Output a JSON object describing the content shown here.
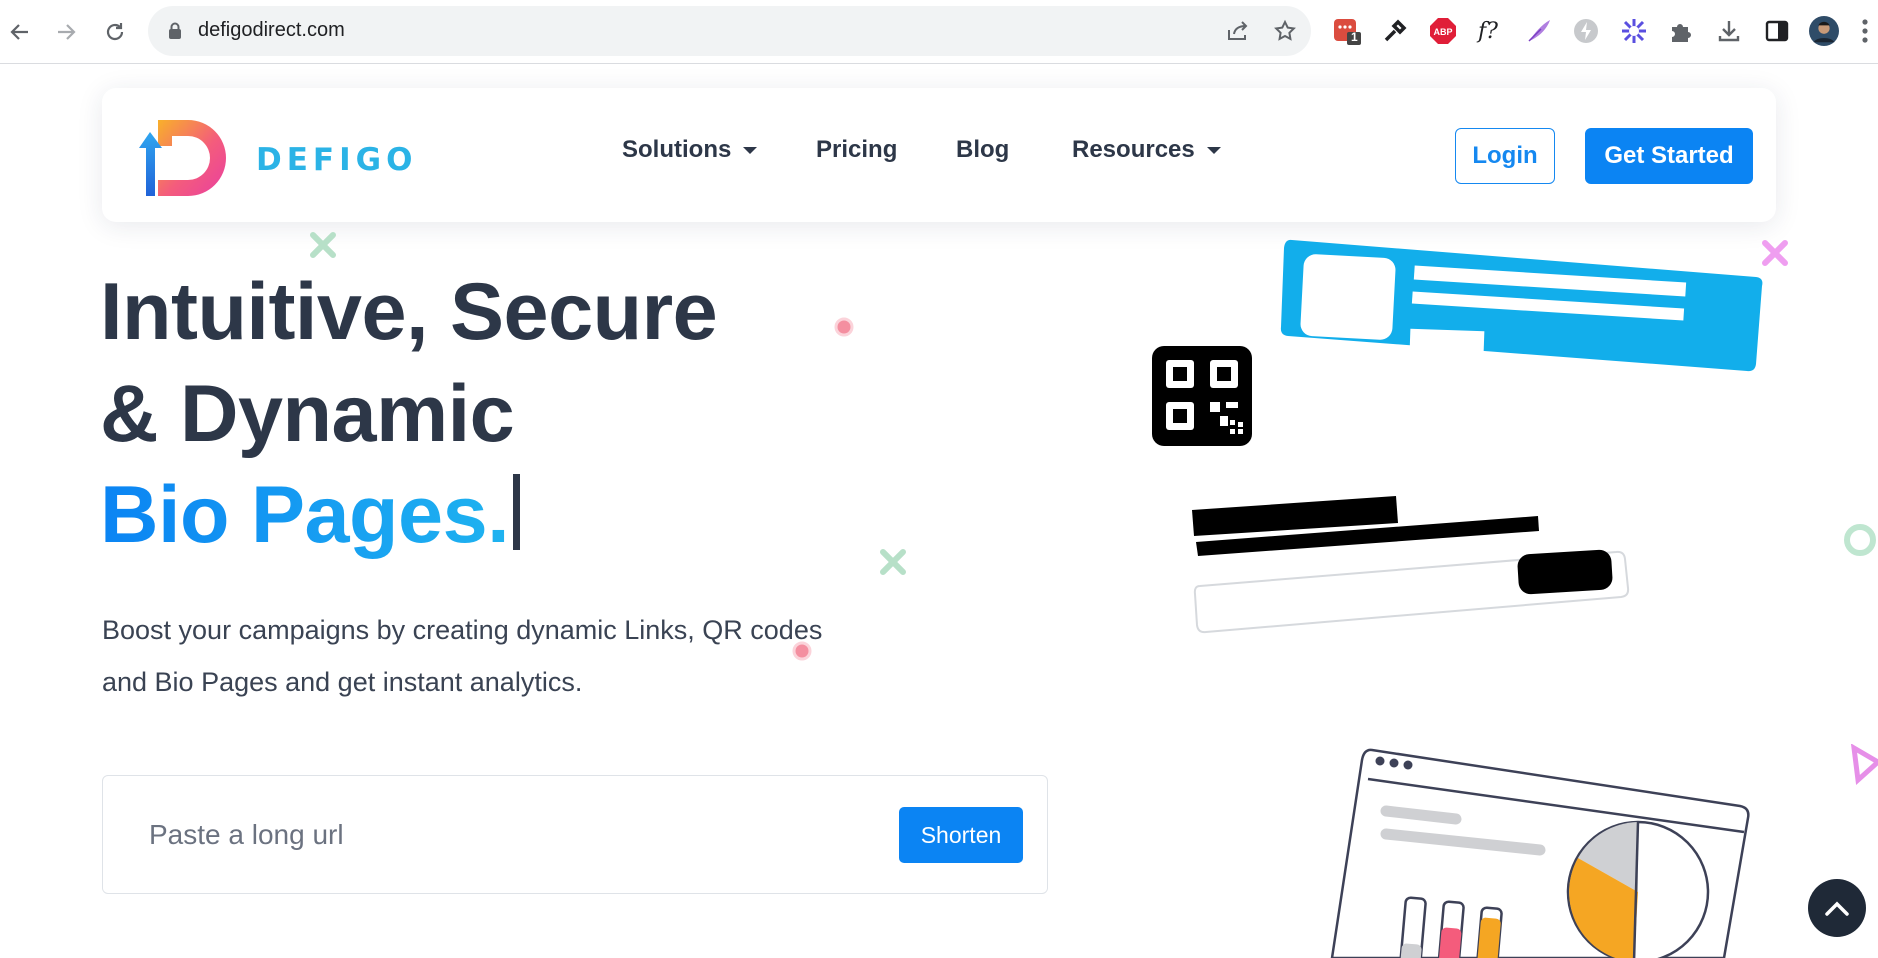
{
  "browser": {
    "url": "defigodirect.com",
    "extension_badge": "1",
    "extensions": [
      "todoist-icon",
      "eyedropper-icon",
      "adblock-icon",
      "whatfont-icon",
      "quill-icon",
      "lightning-icon",
      "asterisk-icon",
      "puzzle-icon",
      "download-icon",
      "sidepanel-icon",
      "profile-avatar-icon",
      "kebab-menu-icon"
    ]
  },
  "brand": {
    "name": "DEFIGO",
    "accent": "#0b84f3",
    "dark": "#2d3748"
  },
  "nav": {
    "solutions": "Solutions",
    "pricing": "Pricing",
    "blog": "Blog",
    "resources": "Resources",
    "login": "Login",
    "get_started": "Get Started"
  },
  "hero": {
    "line1": "Intuitive, Secure",
    "line2": "& Dynamic",
    "line3": "Bio Pages.",
    "subtitle": "Boost your campaigns by creating dynamic Links, QR codes and Bio Pages and get instant analytics."
  },
  "shortener": {
    "placeholder": "Paste a long url",
    "button": "Shorten"
  }
}
